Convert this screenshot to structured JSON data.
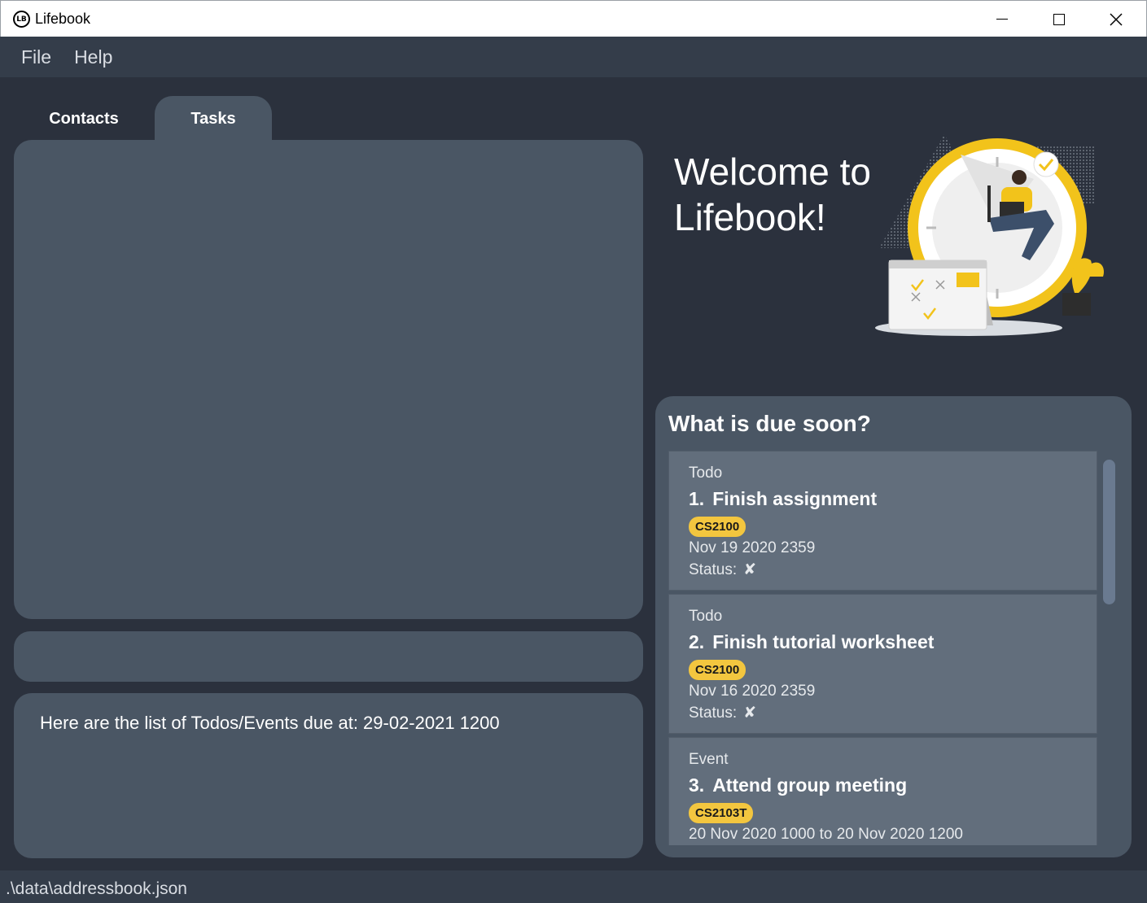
{
  "window": {
    "title": "Lifebook",
    "logo_text": "LB"
  },
  "menu": {
    "items": [
      "File",
      "Help"
    ]
  },
  "tabs": [
    {
      "label": "Contacts",
      "selected": false
    },
    {
      "label": "Tasks",
      "selected": true
    }
  ],
  "result": {
    "message": "Here are the list of Todos/Events due at: 29-02-2021 1200"
  },
  "welcome": {
    "line1": "Welcome to",
    "line2": "Lifebook!"
  },
  "due_soon": {
    "title": "What is due soon?",
    "items": [
      {
        "type": "Todo",
        "index": "1.",
        "name": "Finish assignment",
        "tag": "CS2100",
        "date": "Nov 19 2020 2359",
        "status_label": "Status:",
        "status_icon": "✘"
      },
      {
        "type": "Todo",
        "index": "2.",
        "name": "Finish tutorial worksheet",
        "tag": "CS2100",
        "date": "Nov 16 2020 2359",
        "status_label": "Status:",
        "status_icon": "✘"
      },
      {
        "type": "Event",
        "index": "3.",
        "name": "Attend group meeting",
        "tag": "CS2103T",
        "date": "20 Nov 2020 1000 to 20 Nov 2020 1200"
      }
    ]
  },
  "statusbar": {
    "path": ".\\data\\addressbook.json"
  },
  "colors": {
    "background": "#2b313d",
    "panel": "#4a5664",
    "card": "#626e7c",
    "tag": "#f3c63f",
    "accent_yellow": "#f5c518"
  }
}
